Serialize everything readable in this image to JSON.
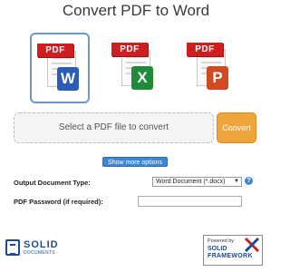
{
  "title": "Convert PDF to Word",
  "formats": [
    {
      "badge": "PDF",
      "office_letter": "W",
      "kind": "word",
      "selected": true
    },
    {
      "badge": "PDF",
      "office_letter": "X",
      "kind": "excel",
      "selected": false
    },
    {
      "badge": "PDF",
      "office_letter": "P",
      "kind": "ppt",
      "selected": false
    }
  ],
  "drop_zone": {
    "label": "Select a PDF file to convert"
  },
  "convert_button": {
    "label": "Convert"
  },
  "more_options_button": {
    "label": "Show more options"
  },
  "output_type": {
    "label": "Output Document Type:",
    "value": "Word Document (*.docx)",
    "caret": "▼",
    "help": "?"
  },
  "password": {
    "label": "PDF Password (if required):",
    "value": ""
  },
  "logo_left": {
    "line1": "SOLID",
    "line2": "DOCUMENTS"
  },
  "logo_right": {
    "line1": "Powered by",
    "line2": "SOLID",
    "line3": "FRAMEWORK"
  },
  "colors": {
    "accent": "#3d86d6",
    "convert": "#f0a43c",
    "pdf_red": "#d01d20",
    "word": "#2b5cb8",
    "excel": "#1f8a3a",
    "ppt": "#d24a21"
  }
}
